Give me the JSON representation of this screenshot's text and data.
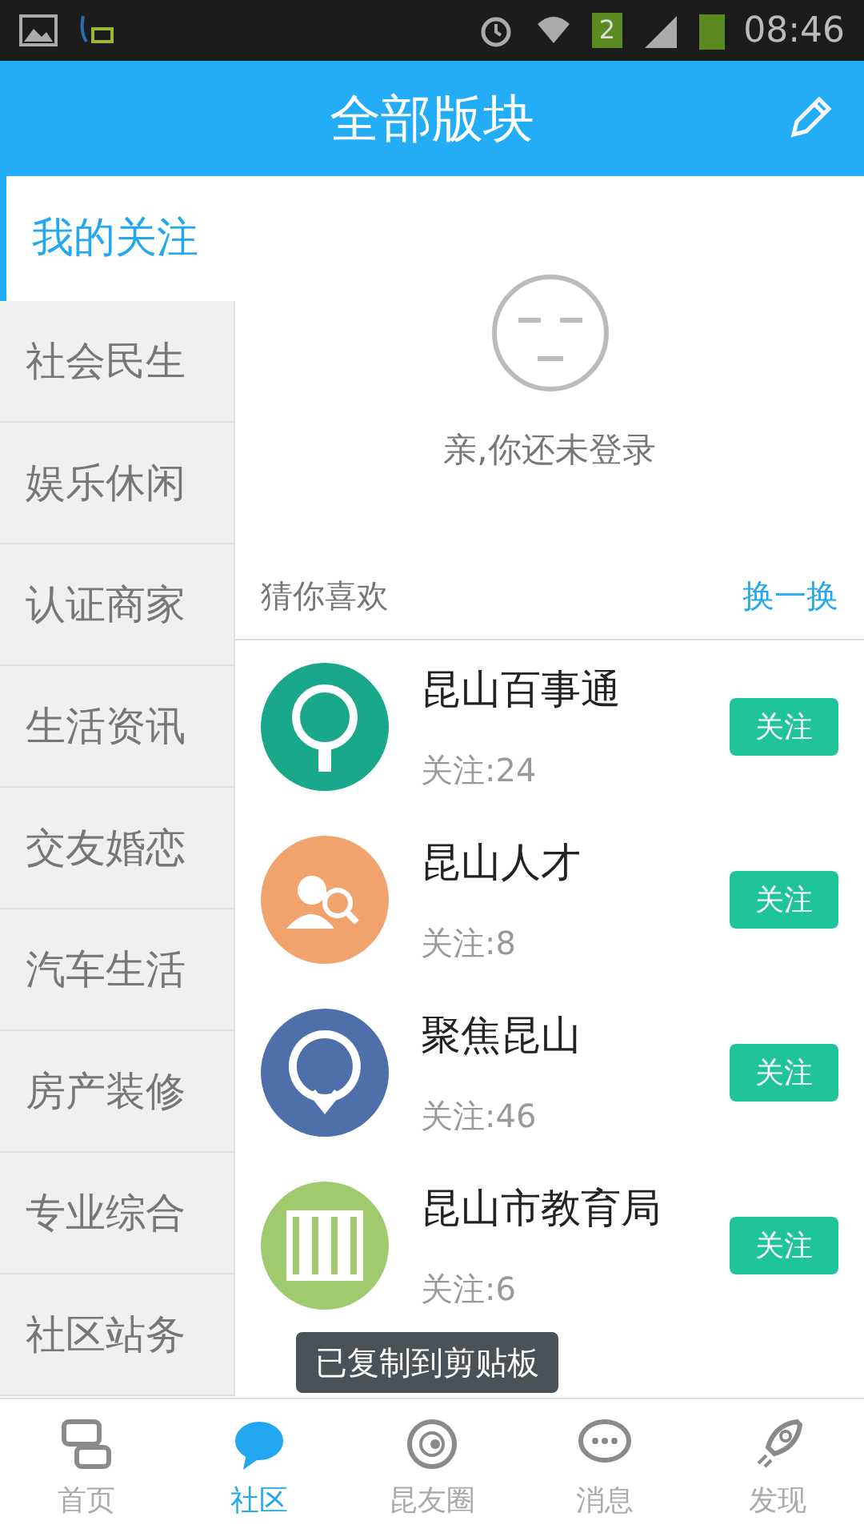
{
  "status_bar": {
    "sim_badge": "2",
    "time": "08:46"
  },
  "header": {
    "title": "全部版块"
  },
  "sidebar": {
    "items": [
      {
        "label": "我的关注",
        "selected": true
      },
      {
        "label": "社会民生",
        "selected": false
      },
      {
        "label": "娱乐休闲",
        "selected": false
      },
      {
        "label": "认证商家",
        "selected": false
      },
      {
        "label": "生活资讯",
        "selected": false
      },
      {
        "label": "交友婚恋",
        "selected": false
      },
      {
        "label": "汽车生活",
        "selected": false
      },
      {
        "label": "房产装修",
        "selected": false
      },
      {
        "label": "专业综合",
        "selected": false
      },
      {
        "label": "社区站务",
        "selected": false
      }
    ]
  },
  "login_prompt": "亲,你还未登录",
  "recommend": {
    "title": "猜你喜欢",
    "refresh": "换一换",
    "items": [
      {
        "name": "昆山百事通",
        "followers": "关注:24",
        "button": "关注",
        "color": "#1aa88a",
        "kind": "pin"
      },
      {
        "name": "昆山人才",
        "followers": "关注:8",
        "button": "关注",
        "color": "#f0a36c",
        "kind": "people"
      },
      {
        "name": "聚焦昆山",
        "followers": "关注:46",
        "button": "关注",
        "color": "#4f6fab",
        "kind": "bubble"
      },
      {
        "name": "昆山市教育局",
        "followers": "关注:6",
        "button": "关注",
        "color": "#9fcb6e",
        "kind": "books"
      }
    ]
  },
  "toast": "已复制到剪贴板",
  "tabs": [
    {
      "label": "首页",
      "selected": false,
      "kind": "chats"
    },
    {
      "label": "社区",
      "selected": true,
      "kind": "bubble"
    },
    {
      "label": "昆友圈",
      "selected": false,
      "kind": "orbit"
    },
    {
      "label": "消息",
      "selected": false,
      "kind": "message"
    },
    {
      "label": "发现",
      "selected": false,
      "kind": "rocket"
    }
  ]
}
